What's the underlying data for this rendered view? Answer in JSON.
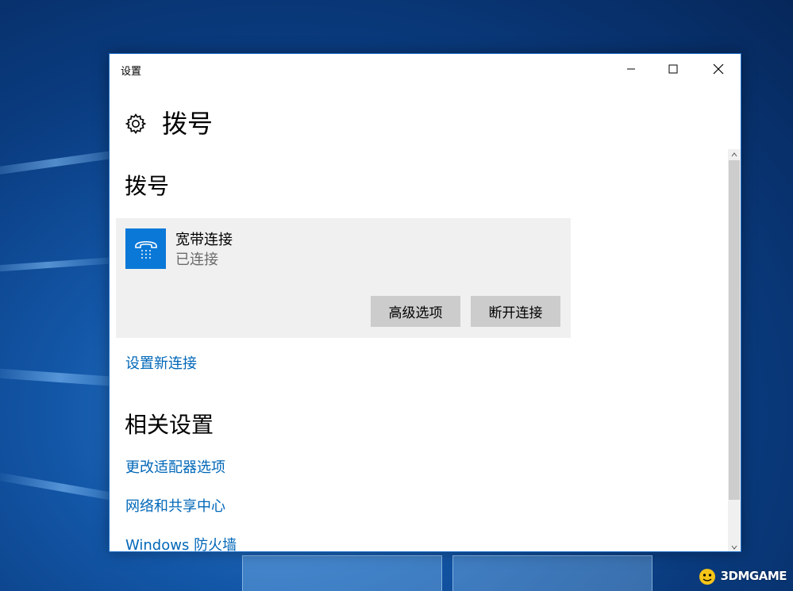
{
  "window": {
    "title": "设置",
    "controls": {
      "minimize": "minimize-icon",
      "maximize": "maximize-icon",
      "close": "close-icon"
    }
  },
  "header": {
    "icon": "gear-icon",
    "title": "拨号"
  },
  "dialup": {
    "heading": "拨号",
    "connection": {
      "icon": "phone-icon",
      "name": "宽带连接",
      "status": "已连接",
      "advanced_label": "高级选项",
      "disconnect_label": "断开连接"
    },
    "new_connection_link": "设置新连接"
  },
  "related": {
    "heading": "相关设置",
    "links": [
      "更改适配器选项",
      "网络和共享中心",
      "Windows 防火墙"
    ]
  },
  "watermark": {
    "text": "3DMGAME"
  },
  "colors": {
    "accent": "#0a78d7",
    "link": "#0067b8",
    "card_bg": "#f0f0f0",
    "button_bg": "#cccccc"
  }
}
